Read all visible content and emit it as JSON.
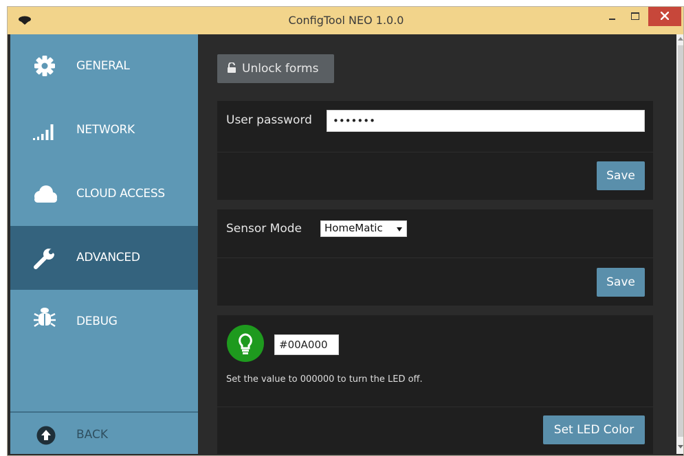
{
  "window": {
    "title": "ConfigTool NEO 1.0.0"
  },
  "sidebar": {
    "items": [
      {
        "label": "GENERAL",
        "icon": "gear-icon"
      },
      {
        "label": "NETWORK",
        "icon": "signal-bars-icon"
      },
      {
        "label": "CLOUD ACCESS",
        "icon": "cloud-icon"
      },
      {
        "label": "ADVANCED",
        "icon": "wrench-icon",
        "active": true
      },
      {
        "label": "DEBUG",
        "icon": "bug-icon"
      }
    ],
    "back_label": "BACK"
  },
  "main": {
    "unlock_label": "Unlock forms",
    "password_panel": {
      "label": "User password",
      "value": "•••••••",
      "save_label": "Save"
    },
    "sensor_panel": {
      "label": "Sensor Mode",
      "selected": "HomeMatic",
      "save_label": "Save"
    },
    "led_panel": {
      "color_value": "#00A000",
      "hint": "Set the value to 000000 to turn the LED off.",
      "button_label": "Set LED Color"
    }
  },
  "colors": {
    "sidebar": "#5e98b5",
    "sidebar_active": "#34637e",
    "titlebar": "#f2d48b",
    "button_blue": "#5a8fab",
    "led_green": "#1e9a1e",
    "close_red": "#c7473a"
  }
}
